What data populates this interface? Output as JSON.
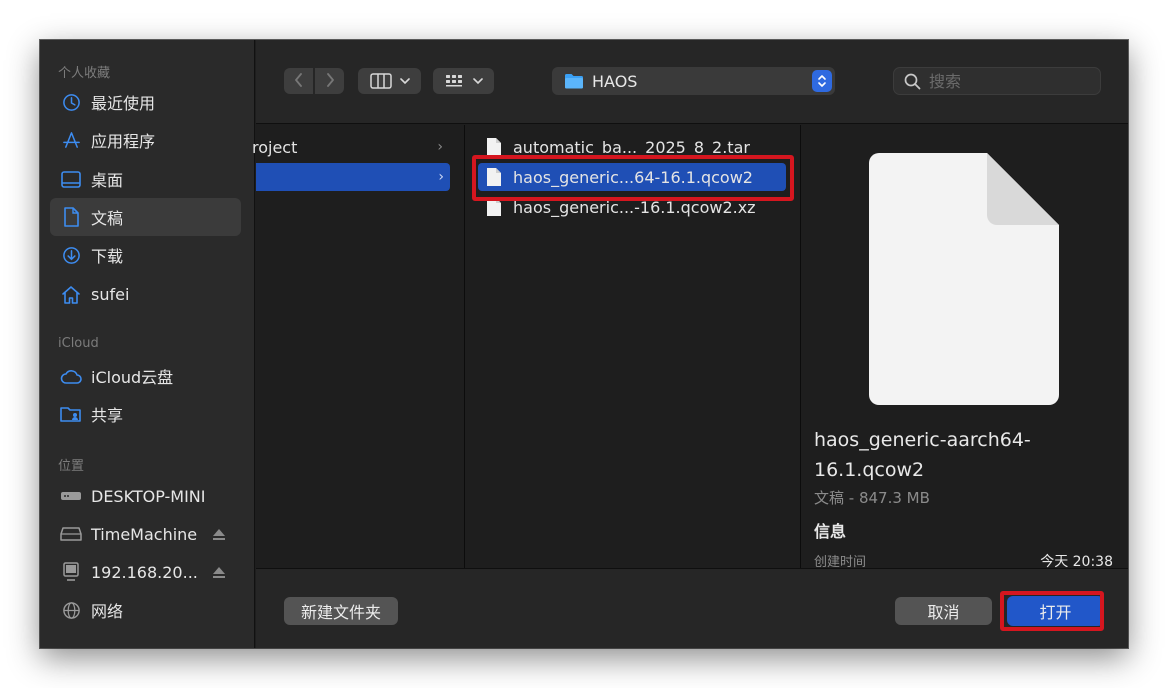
{
  "sidebar": {
    "sections": [
      {
        "title": "个人收藏"
      },
      {
        "title": "iCloud"
      },
      {
        "title": "位置"
      }
    ],
    "favorites": [
      {
        "label": "最近使用",
        "icon": "clock-icon"
      },
      {
        "label": "应用程序",
        "icon": "apps-icon"
      },
      {
        "label": "桌面",
        "icon": "desktop-icon"
      },
      {
        "label": "文稿",
        "icon": "document-icon",
        "active": true
      },
      {
        "label": "下载",
        "icon": "download-icon"
      },
      {
        "label": "sufei",
        "icon": "home-icon"
      }
    ],
    "icloud": [
      {
        "label": "iCloud云盘",
        "icon": "cloud-icon"
      },
      {
        "label": "共享",
        "icon": "shared-folder-icon"
      }
    ],
    "locations": [
      {
        "label": "DESKTOP-MINI",
        "icon": "server-icon"
      },
      {
        "label": "TimeMachine",
        "icon": "drive-icon",
        "eject": true
      },
      {
        "label": "192.168.20...",
        "icon": "monitor-icon",
        "eject": true
      },
      {
        "label": "网络",
        "icon": "globe-icon"
      }
    ]
  },
  "toolbar": {
    "path": "HAOS",
    "search_placeholder": "搜索"
  },
  "columns": {
    "col1": [
      {
        "label": "roject"
      },
      {
        "label": ""
      }
    ],
    "col2": [
      {
        "label": "automatic_ba..._2025_8_2.tar"
      },
      {
        "label": "haos_generic...64-16.1.qcow2",
        "selected": true
      },
      {
        "label": "haos_generic...-16.1.qcow2.xz"
      }
    ]
  },
  "preview": {
    "name": "haos_generic-aarch64-16.1.qcow2",
    "kind_size": "文稿 - 847.3 MB",
    "info_title": "信息",
    "created_label": "创建时间",
    "created_value": "今天 20:38"
  },
  "buttons": {
    "new_folder": "新建文件夹",
    "cancel": "取消",
    "open": "打开"
  },
  "colors": {
    "accent": "#2157c9",
    "highlight": "#d5161f",
    "selection": "#1f4fb5"
  }
}
